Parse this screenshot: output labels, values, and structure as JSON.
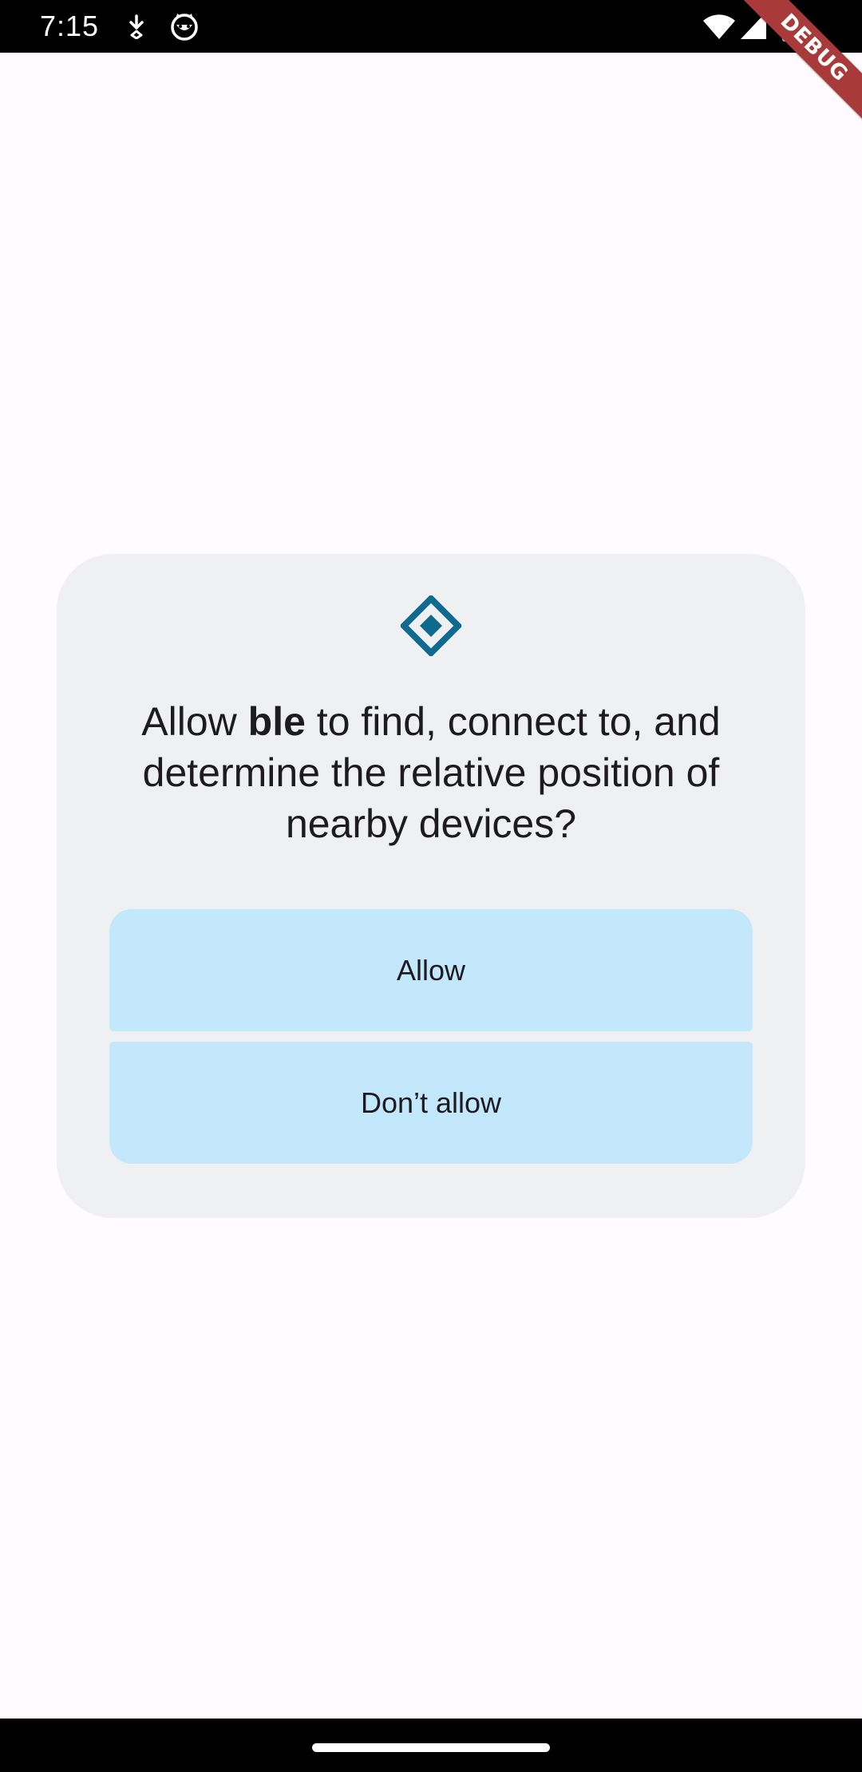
{
  "status_bar": {
    "time": "7:15",
    "left_icons": [
      "download-icon",
      "cat-face-icon"
    ],
    "right_icons": [
      "wifi-icon",
      "cellular-signal-icon",
      "battery-icon"
    ]
  },
  "debug_banner": {
    "label": "DEBUG"
  },
  "dialog": {
    "icon": "nearby-devices-icon",
    "title_prefix": "Allow ",
    "app_name": "ble",
    "title_suffix": " to find, connect to, and determine the relative position of nearby devices?",
    "allow_label": "Allow",
    "deny_label": "Don’t allow"
  },
  "colors": {
    "background": "#fffbfe",
    "dialog_surface": "#eff0f2",
    "button_fill": "#c3e7fb",
    "icon_accent": "#0f6b8e",
    "debug_banner": "#a83a3a"
  }
}
